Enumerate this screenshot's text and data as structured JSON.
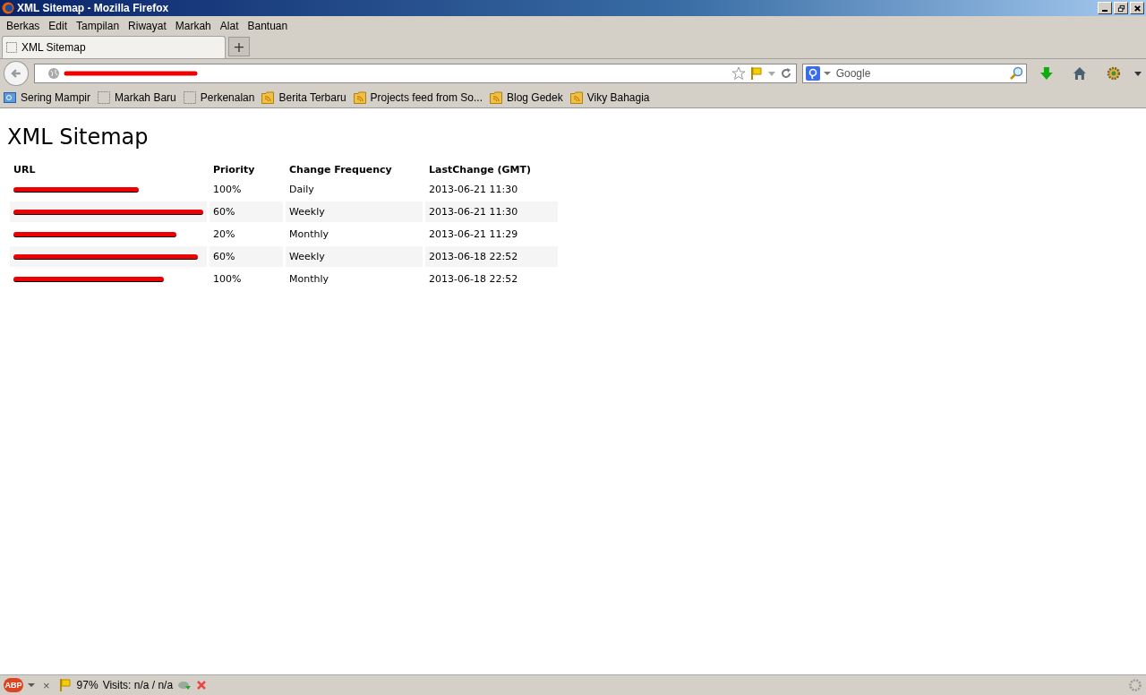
{
  "window": {
    "title": "XML Sitemap - Mozilla Firefox"
  },
  "menu": [
    "Berkas",
    "Edit",
    "Tampilan",
    "Riwayat",
    "Markah",
    "Alat",
    "Bantuan"
  ],
  "tabs": [
    {
      "label": "XML Sitemap",
      "selected": true
    }
  ],
  "new_tab": "+",
  "search": {
    "placeholder": "Google"
  },
  "bookmarks": [
    {
      "label": "Sering Mampir",
      "kind": "smart"
    },
    {
      "label": "Markah Baru",
      "kind": "page"
    },
    {
      "label": "Perkenalan",
      "kind": "page"
    },
    {
      "label": "Berita Terbaru",
      "kind": "feed"
    },
    {
      "label": "Projects feed from So...",
      "kind": "feed"
    },
    {
      "label": "Blog Gedek",
      "kind": "feed"
    },
    {
      "label": "Viky Bahagia",
      "kind": "feed"
    }
  ],
  "page": {
    "heading": "XML Sitemap",
    "table": {
      "columns": [
        "URL",
        "Priority",
        "Change Frequency",
        "LastChange (GMT)"
      ],
      "rows": [
        {
          "priority": "100%",
          "frequency": "Daily",
          "last_change": "2013-06-21 11:30"
        },
        {
          "priority": "60%",
          "frequency": "Weekly",
          "last_change": "2013-06-21 11:30"
        },
        {
          "priority": "20%",
          "frequency": "Monthly",
          "last_change": "2013-06-21 11:29"
        },
        {
          "priority": "60%",
          "frequency": "Weekly",
          "last_change": "2013-06-18 22:52"
        },
        {
          "priority": "100%",
          "frequency": "Monthly",
          "last_change": "2013-06-18 22:52"
        }
      ]
    }
  },
  "status_bar": {
    "adblock_label": "ABP",
    "close": "×",
    "score": "97%",
    "visits": "Visits: n/a / n/a"
  }
}
